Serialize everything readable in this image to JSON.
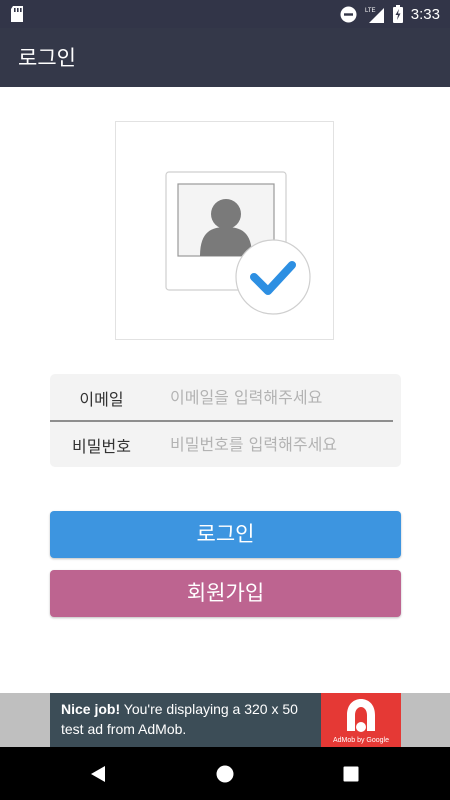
{
  "statusbar": {
    "time": "3:33",
    "network": "LTE"
  },
  "appbar": {
    "title": "로그인"
  },
  "form": {
    "email_label": "이메일",
    "email_placeholder": "이메일을 입력해주세요",
    "password_label": "비밀번호",
    "password_placeholder": "비밀번호를 입력해주세요"
  },
  "buttons": {
    "login": "로그인",
    "signup": "회원가입"
  },
  "ad": {
    "headline": "Nice job!",
    "body": "You're displaying a 320 x 50 test ad from AdMob.",
    "logo_caption": "AdMob by Google"
  },
  "colors": {
    "appbar": "#343849",
    "login_button": "#3d95e0",
    "signup_button": "#bd6490",
    "check": "#2d8fe2"
  }
}
